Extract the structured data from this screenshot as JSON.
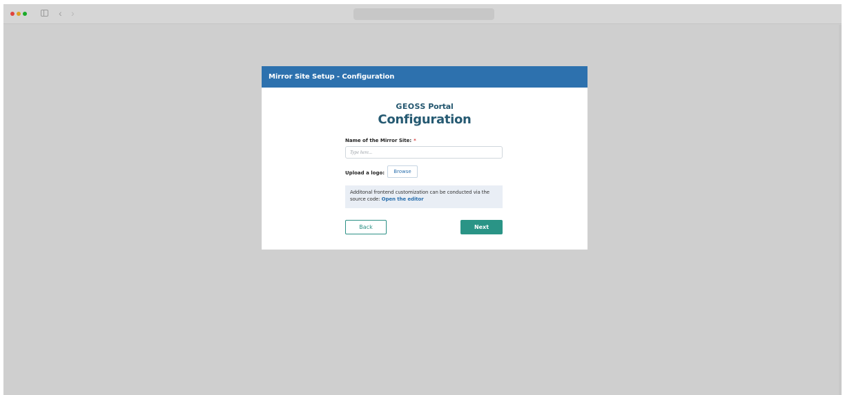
{
  "browser": {
    "back_glyph": "‹",
    "forward_glyph": "›"
  },
  "dialog": {
    "title": "Mirror Site Setup - Configuration",
    "logo_brand": "GEOSS",
    "logo_suffix": " Portal",
    "heading": "Configuration",
    "name_label": "Name of the Mirror Site:",
    "required_mark": "*",
    "name_placeholder": "Type here...",
    "name_value": "",
    "upload_label": "Upload a logo:",
    "browse_label": "Browse",
    "info_text": "Additonal frontend customization can be conducted via the source code: ",
    "info_link": "Open the editor",
    "back_label": "Back",
    "next_label": "Next"
  },
  "colors": {
    "header": "#2d71ae",
    "primary_button": "#2a9486",
    "heading_text": "#265a72",
    "required": "#d63b3b"
  },
  "icons": [
    "close-dot",
    "minimize-dot",
    "zoom-dot",
    "sidebar-icon",
    "chevron-left-icon",
    "chevron-right-icon"
  ]
}
